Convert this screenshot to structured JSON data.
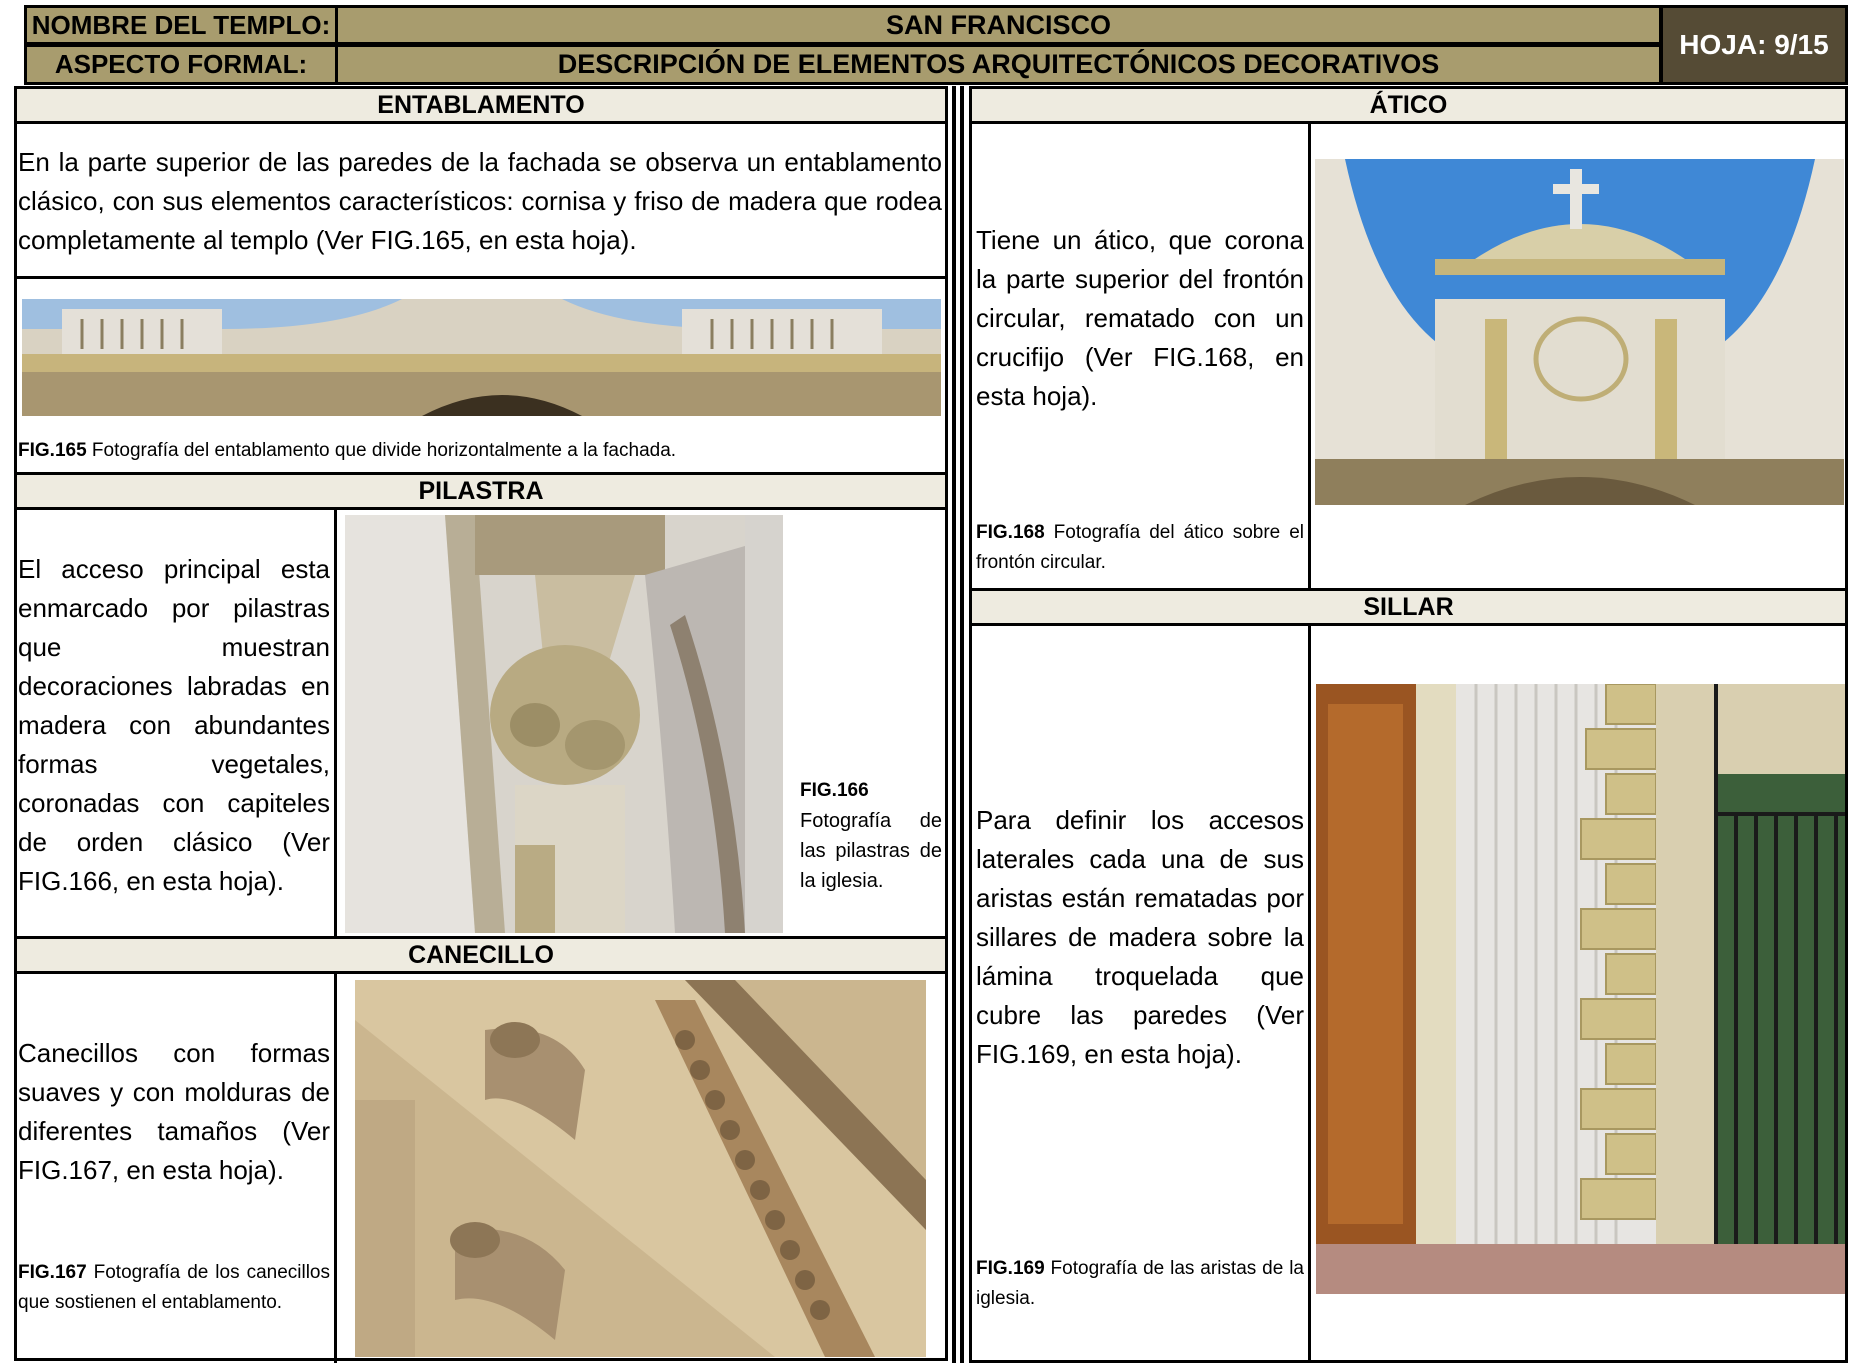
{
  "header": {
    "temple_label": "NOMBRE DEL TEMPLO:",
    "temple_name": "SAN FRANCISCO",
    "aspect_label": "ASPECTO FORMAL:",
    "aspect_value": "DESCRIPCIÓN DE ELEMENTOS ARQUITECTÓNICOS DECORATIVOS",
    "sheet": "HOJA: 9/15"
  },
  "entablamento": {
    "title": "ENTABLAMENTO",
    "text": "En la parte superior de las paredes de la fachada se observa un entablamento clásico, con sus elementos característicos: cornisa y friso de madera que rodea completamente al templo (Ver FIG.165, en esta hoja).",
    "fig_label": "FIG.165",
    "fig_caption": " Fotografía del entablamento que divide horizontalmente a la fachada."
  },
  "pilastra": {
    "title": "PILASTRA",
    "text": "El acceso principal esta enmarcado por pilastras que muestran decoraciones labradas en madera con abundantes formas vegetales, coronadas con capiteles de orden clásico (Ver FIG.166, en esta hoja).",
    "fig_label": "FIG.166",
    "fig_caption": "Fotografía de las pilastras de la iglesia."
  },
  "canecillo": {
    "title": "CANECILLO",
    "text": "Canecillos con formas suaves y con molduras de diferentes tamaños (Ver FIG.167, en esta hoja).",
    "fig_label": "FIG.167",
    "fig_caption": " Fotografía de los canecillos que sostienen el entablamento."
  },
  "atico": {
    "title": "ÁTICO",
    "text": "Tiene un ático, que corona la parte superior del frontón circular, rematado con un crucifijo (Ver FIG.168, en esta hoja).",
    "fig_label": "FIG.168",
    "fig_caption": " Fotografía del ático sobre el frontón circular."
  },
  "sillar": {
    "title": "SILLAR",
    "text": "Para definir los accesos laterales cada una de sus aristas están rematadas por sillares de madera sobre la lámina troquelada que cubre las paredes (Ver FIG.169, en esta hoja).",
    "fig_label": "FIG.169",
    "fig_caption": " Fotografía de las aristas de la iglesia."
  },
  "colors": {
    "header_bg": "#a89c6e",
    "sheet_bg": "#554b35",
    "section_bg": "#eeebe0"
  }
}
